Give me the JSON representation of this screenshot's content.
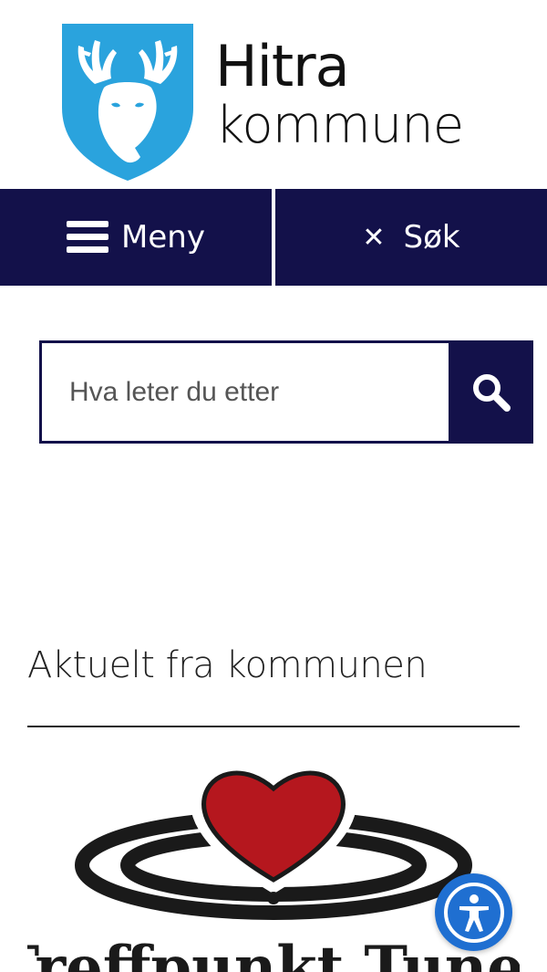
{
  "logo": {
    "line1": "Hitra",
    "line2": "kommune",
    "shield_color": "#2aa3dd",
    "icon": "deer-shield-icon"
  },
  "nav": {
    "menu_label": "Meny",
    "menu_icon": "hamburger-icon",
    "search_label": "Søk",
    "search_icon": "close-icon",
    "background": "#13114a"
  },
  "search": {
    "placeholder": "Hva leter du etter",
    "button_icon": "magnifier-icon"
  },
  "news": {
    "heading": "Aktuelt fra kommunen",
    "image": {
      "logo_icon": "heart-ring-logo",
      "caption_text": "Treffpunkt Tunet",
      "heart_color": "#b5171e"
    }
  },
  "accessibility": {
    "icon": "accessibility-person-icon",
    "color": "#1f6fd1"
  }
}
